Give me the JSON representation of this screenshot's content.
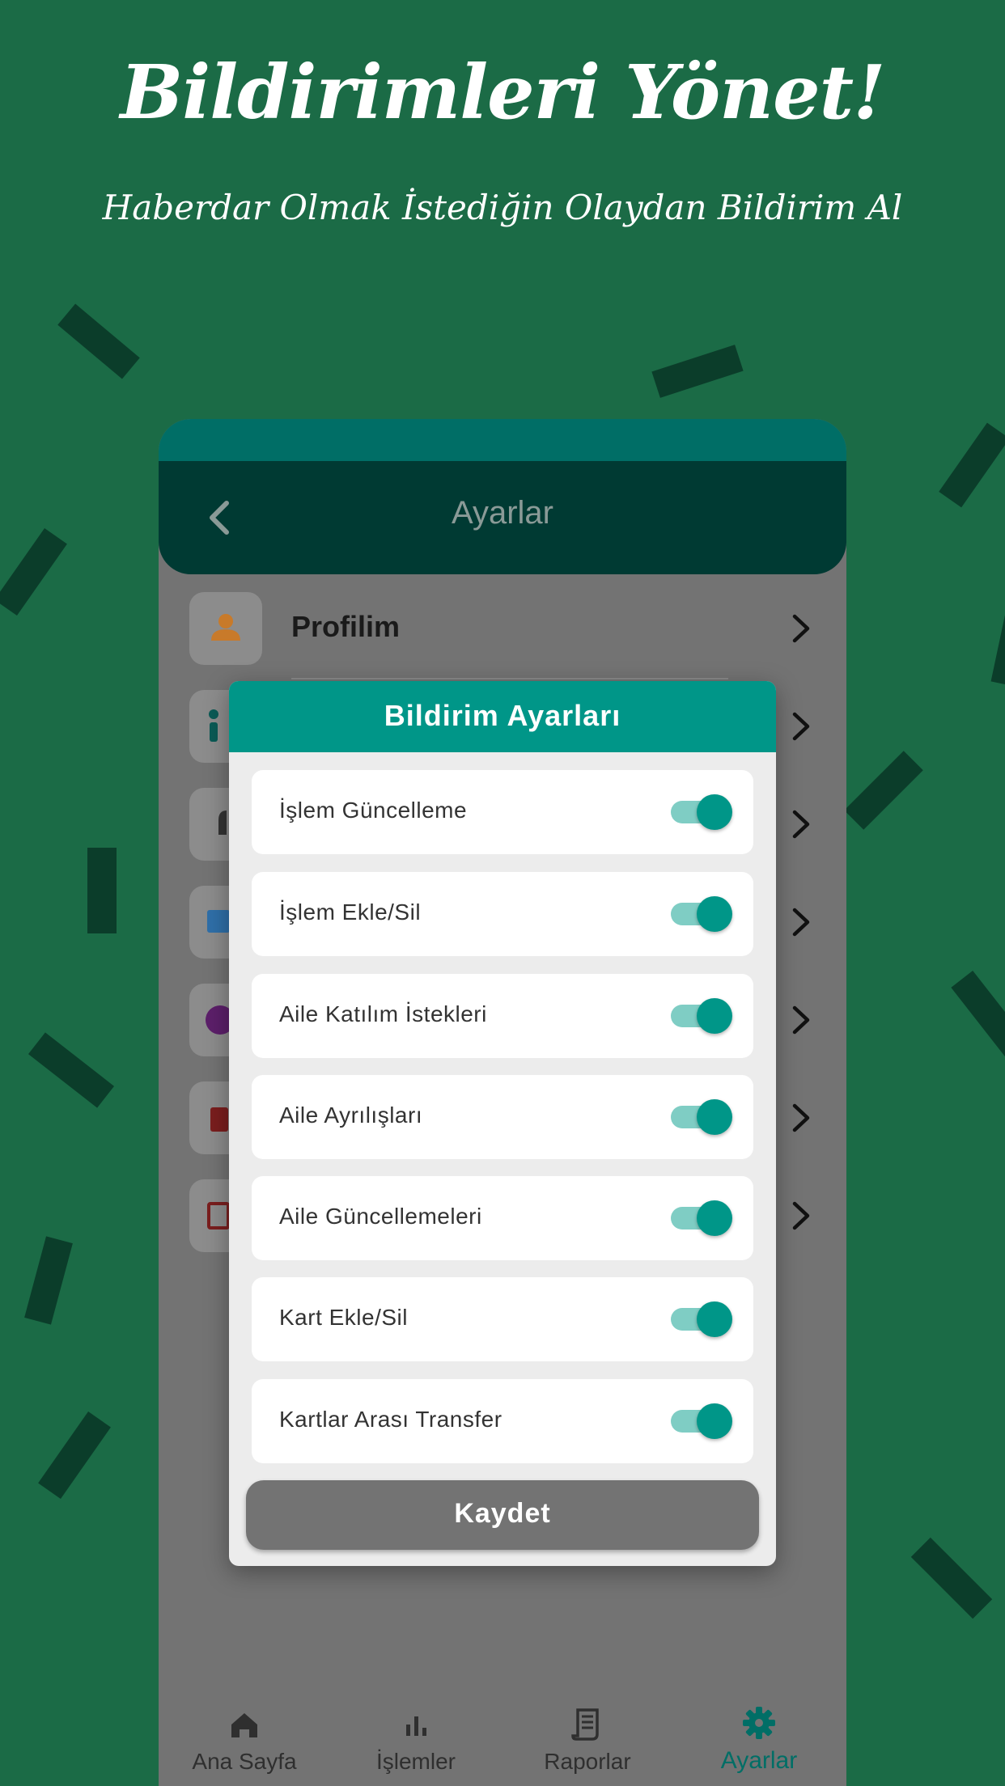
{
  "hero": {
    "title": "Bildirimleri Yönet!",
    "subtitle": "Haberdar Olmak İstediğin Olaydan Bildirim Al"
  },
  "appbar": {
    "title": "Ayarlar",
    "back_icon": "chevron-left-icon"
  },
  "menu": {
    "items": [
      {
        "label": "Profilim",
        "icon": "person-icon",
        "icon_color": "#c87a2a"
      }
    ]
  },
  "modal": {
    "title": "Bildirim Ayarları",
    "settings": [
      {
        "label": "İşlem Güncelleme",
        "enabled": true
      },
      {
        "label": "İşlem Ekle/Sil",
        "enabled": true
      },
      {
        "label": "Aile Katılım İstekleri",
        "enabled": true
      },
      {
        "label": "Aile Ayrılışları",
        "enabled": true
      },
      {
        "label": "Aile Güncellemeleri",
        "enabled": true
      },
      {
        "label": "Kart Ekle/Sil",
        "enabled": true
      },
      {
        "label": "Kartlar Arası Transfer",
        "enabled": true
      }
    ],
    "save_label": "Kaydet"
  },
  "bottom_nav": {
    "items": [
      {
        "label": "Ana Sayfa",
        "icon": "home-icon",
        "active": false
      },
      {
        "label": "İşlemler",
        "icon": "bar-chart-icon",
        "active": false
      },
      {
        "label": "Raporlar",
        "icon": "receipt-icon",
        "active": false
      },
      {
        "label": "Ayarlar",
        "icon": "gear-icon",
        "active": true
      }
    ]
  },
  "colors": {
    "background": "#1b6b46",
    "accent": "#009688",
    "appbar": "#003a33",
    "toggle_track": "#7fcdc4"
  }
}
